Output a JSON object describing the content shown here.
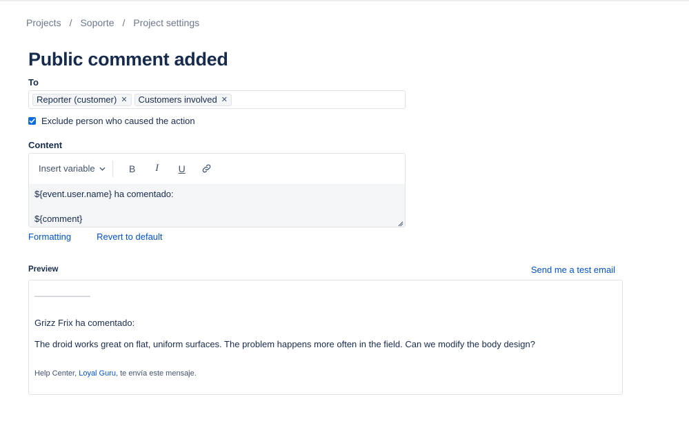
{
  "breadcrumb": {
    "items": [
      "Projects",
      "Soporte",
      "Project settings"
    ],
    "separator": "/"
  },
  "page_title": "Public comment added",
  "to": {
    "label": "To",
    "recipients": [
      {
        "label": "Reporter (customer)"
      },
      {
        "label": "Customers involved"
      }
    ]
  },
  "exclude_checkbox": {
    "label": "Exclude person who caused the action",
    "checked": true
  },
  "content": {
    "label": "Content",
    "toolbar": {
      "insert_variable": "Insert variable",
      "bold": "B",
      "italic": "I",
      "underline": "U",
      "link_icon": "link-icon"
    },
    "body_line1": "${event.user.name} ha comentado:",
    "body_line2": "${comment}"
  },
  "actions": {
    "formatting": "Formatting",
    "revert": "Revert to default"
  },
  "preview": {
    "label": "Preview",
    "send_test": "Send me a test email",
    "rule": "————————",
    "line1": "Grizz Frix ha comentado:",
    "line2": "The droid works great on flat, uniform surfaces. The problem happens more often in the field. Can we modify the body design?",
    "footer_prefix": "Help Center, ",
    "footer_link": "Loyal Guru",
    "footer_suffix": ", te envía este mensaje."
  },
  "colors": {
    "link": "#0052cc",
    "title": "#172b4d",
    "checkbox": "#0b6bde",
    "muted": "#6b778c"
  }
}
